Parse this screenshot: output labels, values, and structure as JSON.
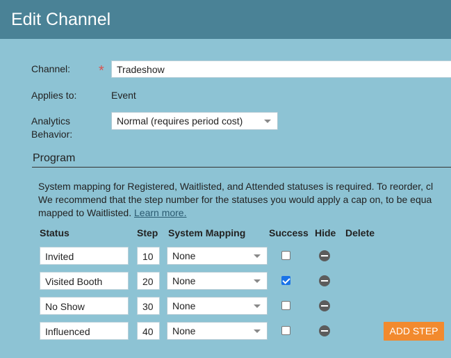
{
  "window": {
    "title": "Edit Channel"
  },
  "form": {
    "channel_label": "Channel:",
    "required_mark": "*",
    "channel_value": "Tradeshow",
    "applies_label": "Applies to:",
    "applies_value": "Event",
    "analytics_label_line1": "Analytics",
    "analytics_label_line2": "Behavior:",
    "analytics_value": "Normal (requires period cost)"
  },
  "program": {
    "title": "Program",
    "description_line1": "System mapping for Registered, Waitlisted, and Attended statuses is required. To reorder, cl",
    "description_line2": "We recommend that the step number for the statuses you would apply a cap on, to be equa",
    "description_line3": "mapped to Waitlisted.",
    "learn_more": "Learn more.",
    "columns": {
      "status": "Status",
      "step": "Step",
      "system_mapping": "System Mapping",
      "success": "Success",
      "hide": "Hide",
      "delete": "Delete"
    },
    "rows": [
      {
        "status": "Invited",
        "step": "10",
        "mapping": "None",
        "success": false
      },
      {
        "status": "Visited Booth",
        "step": "20",
        "mapping": "None",
        "success": true
      },
      {
        "status": "No Show",
        "step": "30",
        "mapping": "None",
        "success": false
      },
      {
        "status": "Influenced",
        "step": "40",
        "mapping": "None",
        "success": false
      }
    ],
    "add_step_label": "ADD STEP"
  },
  "colors": {
    "background": "#8dc3d4",
    "titlebar": "#4a8296",
    "accent_button": "#f28a2e",
    "checkbox_checked": "#1a73e8"
  }
}
